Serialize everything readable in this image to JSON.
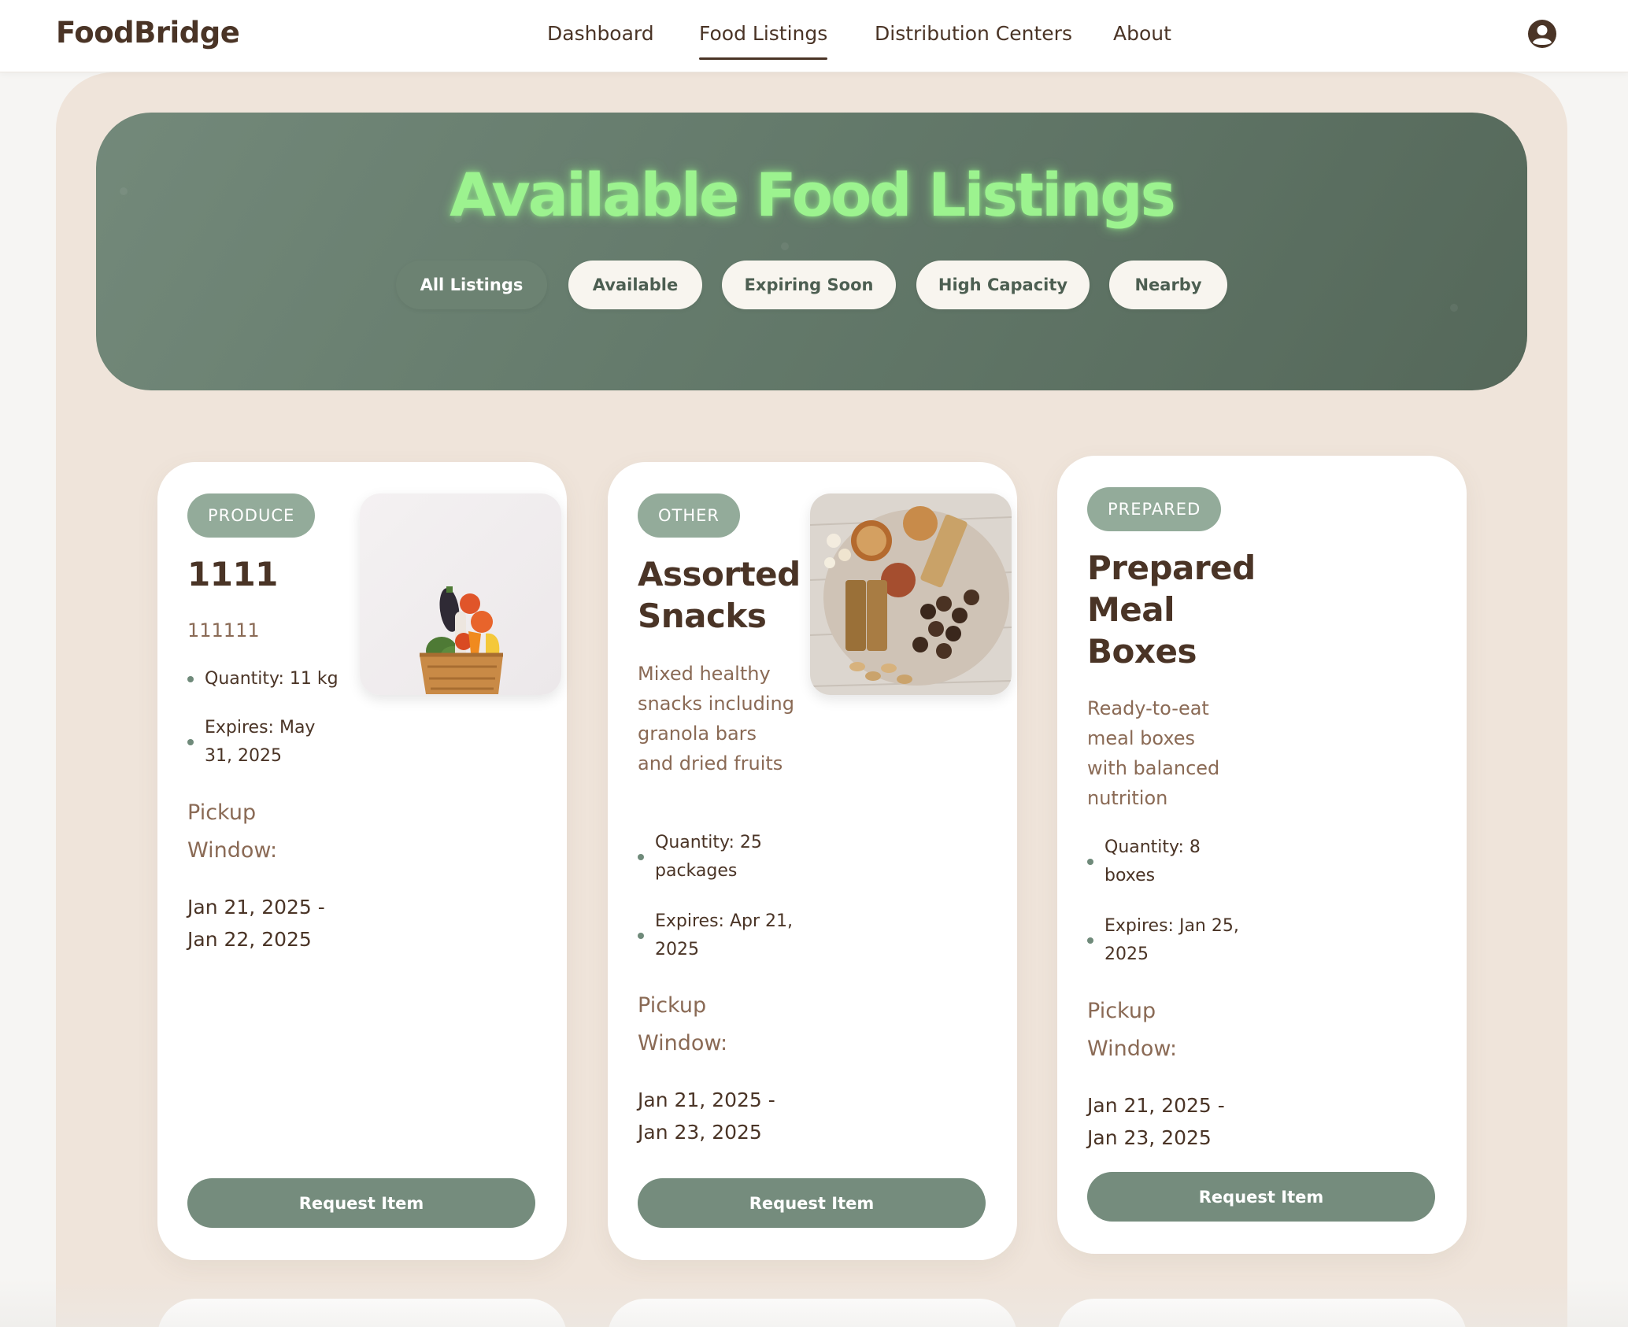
{
  "app": {
    "brand": "FoodBridge"
  },
  "nav": {
    "items": [
      {
        "label": "Dashboard"
      },
      {
        "label": "Food Listings",
        "active": true
      },
      {
        "label": "Distribution Centers"
      },
      {
        "label": "About"
      }
    ],
    "profile_icon": "user-circle-icon"
  },
  "hero": {
    "title": "Available Food Listings",
    "filters": [
      {
        "label": "All Listings",
        "active": true
      },
      {
        "label": "Available"
      },
      {
        "label": "Expiring Soon"
      },
      {
        "label": "High Capacity"
      },
      {
        "label": "Nearby"
      }
    ]
  },
  "listings": [
    {
      "category": "PRODUCE",
      "title": "1111",
      "description": "111111",
      "quantity": "Quantity: 11 kg",
      "expires": "Expires: May 31, 2025",
      "pickup_label": "Pickup Window:",
      "pickup_dates": "Jan 21, 2025 - Jan 22, 2025",
      "action": "Request Item",
      "image": "vegetable-basket-photo"
    },
    {
      "category": "OTHER",
      "title": "Assorted Snacks",
      "description": "Mixed healthy snacks including granola bars and dried fruits",
      "quantity": "Quantity: 25 packages",
      "expires": "Expires: Apr 21, 2025",
      "pickup_label": "Pickup Window:",
      "pickup_dates": "Jan 21, 2025 - Jan 23, 2025",
      "action": "Request Item",
      "image": "snack-platter-photo"
    },
    {
      "category": "PREPARED",
      "title": "Prepared Meal Boxes",
      "description": "Ready-to-eat meal boxes with balanced nutrition",
      "quantity": "Quantity: 8 boxes",
      "expires": "Expires: Jan 25, 2025",
      "pickup_label": "Pickup Window:",
      "pickup_dates": "Jan 21, 2025 - Jan 23, 2025",
      "action": "Request Item"
    }
  ],
  "colors": {
    "brand_text": "#4a3426",
    "hero_title": "#9cf38f",
    "accent_green": "#758c7d",
    "badge": "#93ab9a",
    "panel_bg": "#efe4da"
  }
}
